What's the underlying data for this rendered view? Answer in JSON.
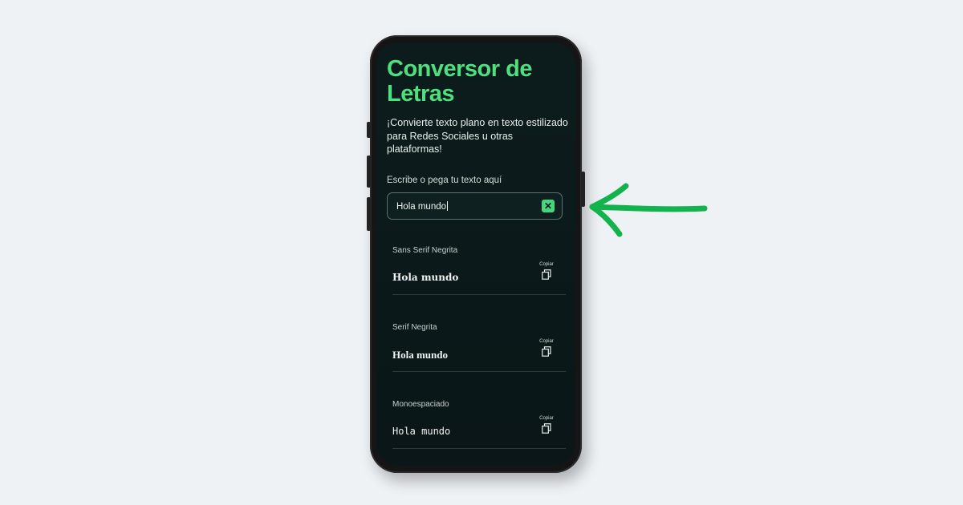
{
  "app": {
    "title": "Conversor de Letras",
    "subtitle": "¡Convierte texto plano en texto estilizado para Redes Sociales u otras plataformas!"
  },
  "input": {
    "label": "Escribe o pega tu texto aquí",
    "value": "Hola mundo",
    "clear_icon": "close-icon"
  },
  "styles": [
    {
      "name": "Sans Serif Negrita",
      "sample": "Hola mundo",
      "copy_label": "Copiar"
    },
    {
      "name": "Serif Negrita",
      "sample": "Hola mundo",
      "copy_label": "Copiar"
    },
    {
      "name": "Monoespaciado",
      "sample": "Hola mundo",
      "copy_label": "Copiar"
    }
  ],
  "colors": {
    "accent": "#4ee07f",
    "screen_bg": "#0b1a1b",
    "page_bg": "#eef2f5",
    "arrow": "#12b24d"
  }
}
